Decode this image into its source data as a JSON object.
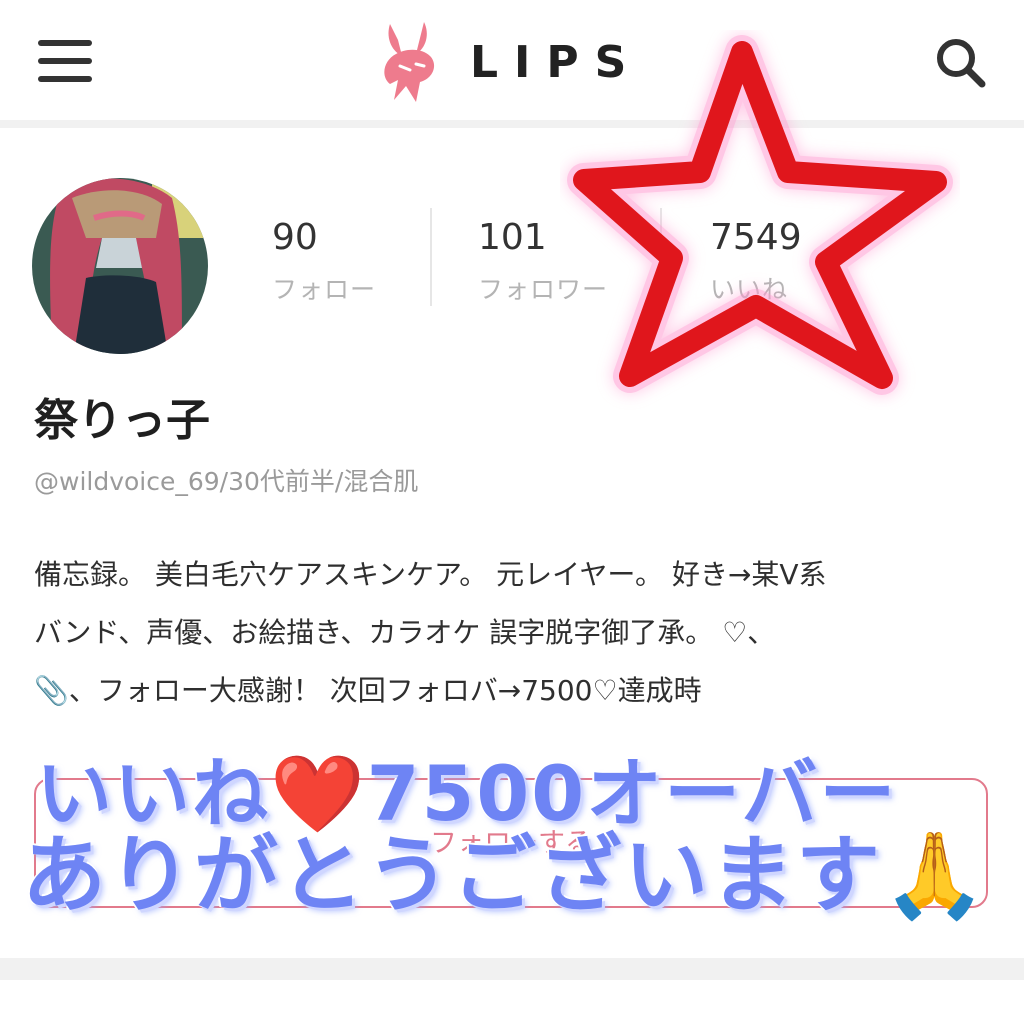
{
  "header": {
    "logo_text": "LIPS",
    "brand_color": "#ee7b8d"
  },
  "profile": {
    "stats": [
      {
        "value": "90",
        "label": "フォロー"
      },
      {
        "value": "101",
        "label": "フォロワー"
      },
      {
        "value": "7549",
        "label": "いいね"
      }
    ],
    "username": "祭りっ子",
    "userinfo": "@wildvoice_69/30代前半/混合肌",
    "bio_lines": [
      "備忘録。 美白毛穴ケアスキンケア。 元レイヤー。 好き→某V系",
      "バンド、声優、お絵描き、カラオケ 誤字脱字御了承。 ♡、",
      "、フォロー大感謝！ 次回フォロバ→7500♡達成時"
    ],
    "bio_clip_icon": "📎",
    "follow_button_label": "フォローする"
  },
  "overlay": {
    "line1_a": "いいね",
    "line1_heart": "❤️",
    "line1_b": "7500オーバー",
    "line2_a": "ありがとうございます",
    "line2_pray": "🙏",
    "text_color": "#6e84f4",
    "star_color": "#e0161c"
  }
}
